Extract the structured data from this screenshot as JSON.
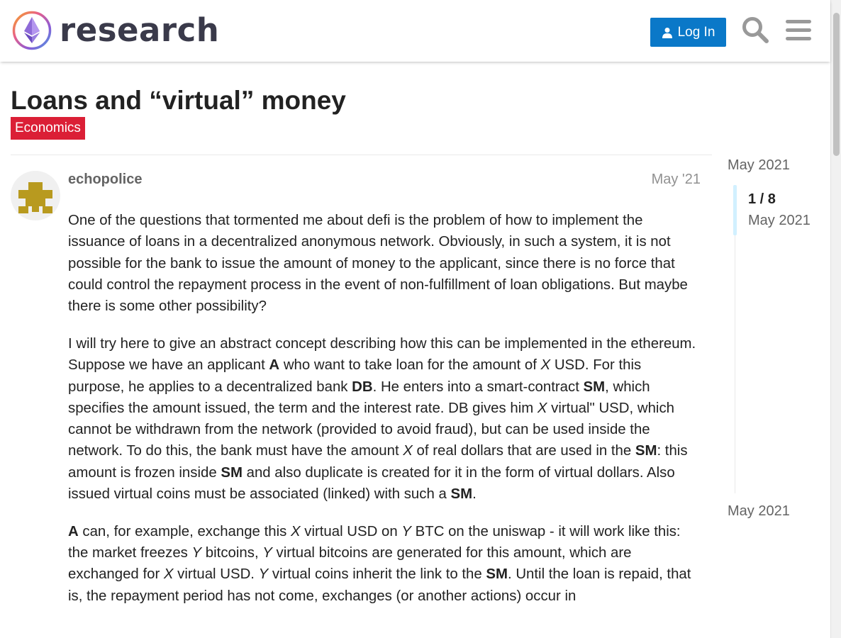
{
  "header": {
    "logo_text": "research",
    "login_label": "Log In",
    "search_icon": "search-icon",
    "menu_icon": "hamburger-menu-icon"
  },
  "topic": {
    "title": "Loans and “virtual” money",
    "category": "Economics",
    "category_color": "#db1f36"
  },
  "post": {
    "username": "echopolice",
    "date": "May '21",
    "p1": "One of the questions that tormented me about defi is the problem of how to implement the issuance of loans in a decentralized anonymous network. Obviously, in such a system, it is not possible for the bank to issue the amount of money to the applicant, since there is no force that could control the repayment process in the event of non-fulfillment of loan obligations. But maybe there is some other possibility?",
    "p2": "I will try here to give an abstract concept describing how this can be implemented in the ethereum.",
    "p3": [
      {
        "t": "Suppose we have an applicant "
      },
      {
        "t": "A",
        "s": "b"
      },
      {
        "t": " who want to take loan for the amount of "
      },
      {
        "t": "X",
        "s": "i"
      },
      {
        "t": " USD. For this purpose, he applies to a decentralized bank "
      },
      {
        "t": "DB",
        "s": "b"
      },
      {
        "t": ". He enters into a smart-contract "
      },
      {
        "t": "SM",
        "s": "b"
      },
      {
        "t": ", which specifies the amount issued, the term and the interest rate. DB gives him "
      },
      {
        "t": "X",
        "s": "i"
      },
      {
        "t": " virtual\" USD, which cannot be withdrawn from the network (provided to avoid fraud), but can be used inside the network. To do this, the bank must have the amount "
      },
      {
        "t": "X",
        "s": "i"
      },
      {
        "t": " of real dollars that are used in the "
      },
      {
        "t": "SM",
        "s": "b"
      },
      {
        "t": ": this amount is frozen inside "
      },
      {
        "t": "SM",
        "s": "b"
      },
      {
        "t": " and also duplicate is created for it in the form of virtual dollars. Also issued virtual coins must be associated (linked) with such a "
      },
      {
        "t": "SM",
        "s": "b"
      },
      {
        "t": "."
      }
    ],
    "p4": [
      {
        "t": "A",
        "s": "b"
      },
      {
        "t": " can, for example, exchange this "
      },
      {
        "t": "X",
        "s": "i"
      },
      {
        "t": " virtual USD on "
      },
      {
        "t": "Y",
        "s": "i"
      },
      {
        "t": " BTC on the uniswap - it will work like this:"
      }
    ],
    "p5": [
      {
        "t": "the market freezes "
      },
      {
        "t": "Y",
        "s": "i"
      },
      {
        "t": " bitcoins, "
      },
      {
        "t": "Y",
        "s": "i"
      },
      {
        "t": " virtual bitcoins are generated for this amount, which are exchanged for "
      },
      {
        "t": "X",
        "s": "i"
      },
      {
        "t": " virtual USD. "
      },
      {
        "t": "Y",
        "s": "i"
      },
      {
        "t": " virtual coins inherit the link to the "
      },
      {
        "t": "SM",
        "s": "b"
      },
      {
        "t": ". Until the loan is repaid, that is, the repayment period has not come, exchanges (or another actions) occur in"
      }
    ]
  },
  "timeline": {
    "start_date": "May 2021",
    "position": "1 / 8",
    "current_date": "May 2021",
    "end_date": "May 2021"
  }
}
